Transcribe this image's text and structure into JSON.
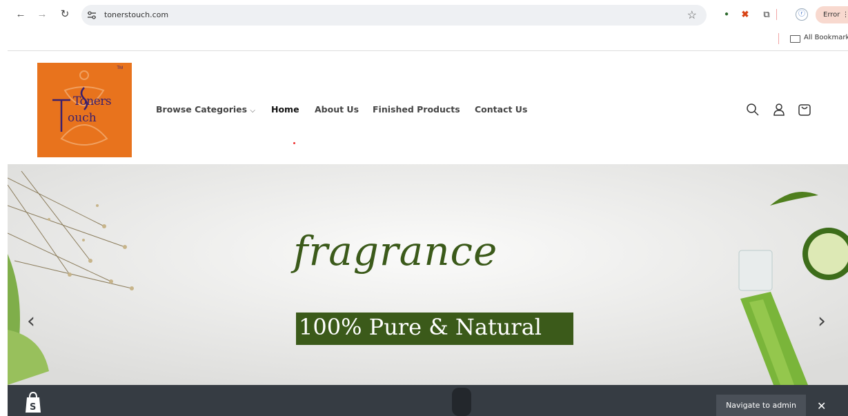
{
  "browser": {
    "url": "tonerstouch.com",
    "error_label": "Error",
    "bookmarks_label": "All Bookmarks",
    "back_icon": "arrow-left-icon",
    "forward_icon": "arrow-right-icon",
    "reload_icon": "reload-icon"
  },
  "logo": {
    "line1": "Toners",
    "line2": "ouch",
    "tm": "TM"
  },
  "nav": {
    "browse": "Browse Categories",
    "home": "Home",
    "about": "About Us",
    "finished": "Finished Products",
    "contact": "Contact Us"
  },
  "hero": {
    "title": "fragrance",
    "badge": "100% Pure & Natural",
    "prev": "‹",
    "next": "›"
  },
  "admin_bar": {
    "navigate": "Navigate to admin",
    "close": "✕"
  },
  "colors": {
    "brand_orange": "#e8731d",
    "hero_green": "#3b5a1a",
    "admin_bg": "#363c43"
  }
}
